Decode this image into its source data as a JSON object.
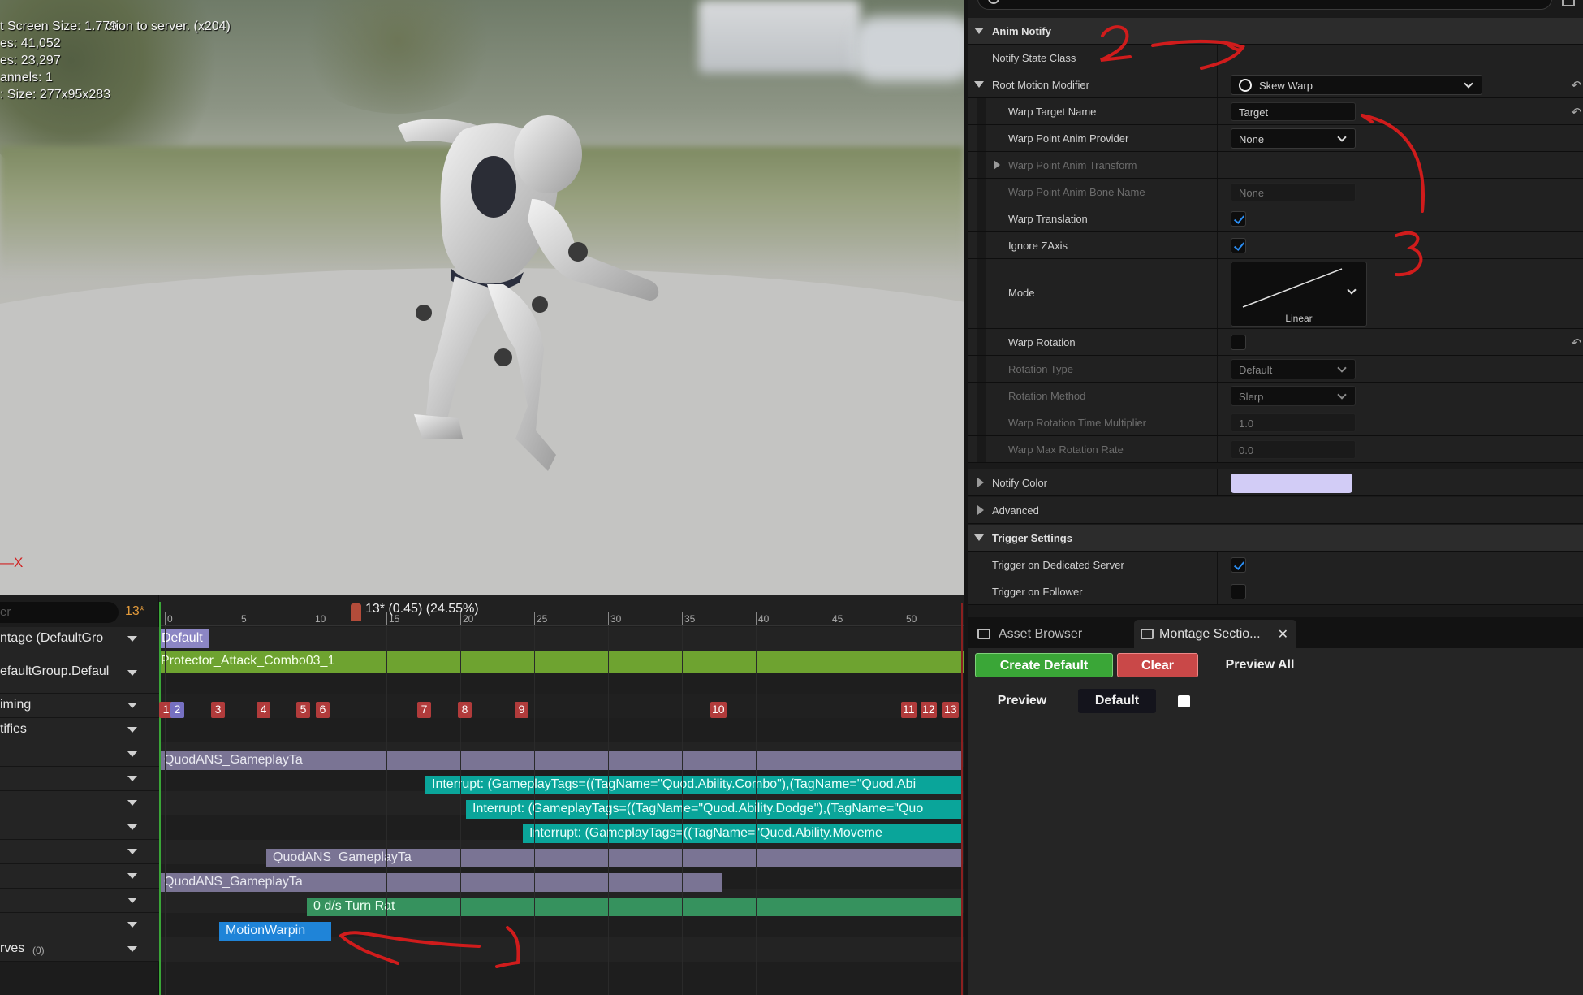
{
  "viewport": {
    "stats": [
      "t Screen Size: 1.779",
      "es: 41,052",
      "es: 23,297",
      "annels: 1",
      ": Size: 277x95x283"
    ],
    "warning": "ction to server. (x204)",
    "axis_label": "X"
  },
  "details": {
    "rows": {
      "anim_notify": "Anim Notify",
      "notify_state_class": "Notify State Class",
      "root_motion_modifier": "Root Motion Modifier",
      "root_motion_modifier_value": "Skew Warp",
      "warp_target_name": "Warp Target Name",
      "warp_target_name_value": "Target",
      "warp_point_anim_provider": "Warp Point Anim Provider",
      "warp_point_anim_provider_value": "None",
      "warp_point_anim_transform": "Warp Point Anim Transform",
      "warp_point_anim_bone_name": "Warp Point Anim Bone Name",
      "warp_point_anim_bone_name_value": "None",
      "warp_translation": "Warp Translation",
      "ignore_zaxis": "Ignore ZAxis",
      "mode": "Mode",
      "mode_value": "Linear",
      "warp_rotation": "Warp Rotation",
      "rotation_type": "Rotation Type",
      "rotation_type_value": "Default",
      "rotation_method": "Rotation Method",
      "rotation_method_value": "Slerp",
      "warp_rotation_time_multiplier": "Warp Rotation Time Multiplier",
      "warp_rotation_time_multiplier_value": "1.0",
      "warp_max_rotation_rate": "Warp Max Rotation Rate",
      "warp_max_rotation_rate_value": "0.0",
      "notify_color": "Notify Color",
      "advanced": "Advanced",
      "trigger_settings": "Trigger Settings",
      "trigger_on_dedicated_server": "Trigger on Dedicated Server",
      "trigger_on_follower": "Trigger on Follower"
    },
    "checks": {
      "warp_translation": true,
      "ignore_zaxis": true,
      "warp_rotation": false,
      "trigger_on_dedicated_server": true,
      "trigger_on_follower": false
    },
    "notify_color_hex": "#d2ccf6"
  },
  "tabs": {
    "asset_browser": "Asset Browser",
    "montage_sections": "Montage Sectio...",
    "close_glyph": "✕",
    "create_default": "Create Default",
    "clear": "Clear",
    "preview_all": "Preview All",
    "preview": "Preview",
    "default": "Default"
  },
  "timeline": {
    "filter_placeholder": "er",
    "current_frame": "13*",
    "playhead_label": "13* (0.45) (24.55%)",
    "ruler_ticks": [
      "0",
      "5",
      "10",
      "15",
      "20",
      "25",
      "30",
      "35",
      "40",
      "45",
      "50"
    ],
    "track_labels": {
      "montage": "ntage (DefaultGro",
      "slot": "efaultGroup.Defaul",
      "timing": "iming",
      "notifies": "tifies",
      "curves": "rves",
      "curves_count": "(0)"
    },
    "section_label": "Default",
    "slot_clip": "Protector_Attack_Combo03_1",
    "timing_markers": [
      "1",
      "2",
      "3",
      "4",
      "5",
      "6",
      "7",
      "8",
      "9",
      "10",
      "11",
      "12",
      "13"
    ],
    "notify_bars": [
      "QuodANS_GameplayTa",
      "Interrupt: (GameplayTags=((TagName=\"Quod.Ability.Combo\"),(TagName=\"Quod.Abi",
      "Interrupt: (GameplayTags=((TagName=\"Quod.Ability.Dodge\"),(TagName=\"Quo",
      "Interrupt: (GameplayTags=((TagName=\"Quod.Ability.Moveme",
      "QuodANS_GameplayTa",
      "QuodANS_GameplayTa",
      "0 d/s Turn Rat",
      "MotionWarpin"
    ]
  },
  "colors": {
    "accent_blue": "#2b8ef4",
    "create_green": "#3aa637",
    "clear_red": "#c94848",
    "annotation_red": "#d01c1c",
    "playhead": "#b34c3a"
  }
}
